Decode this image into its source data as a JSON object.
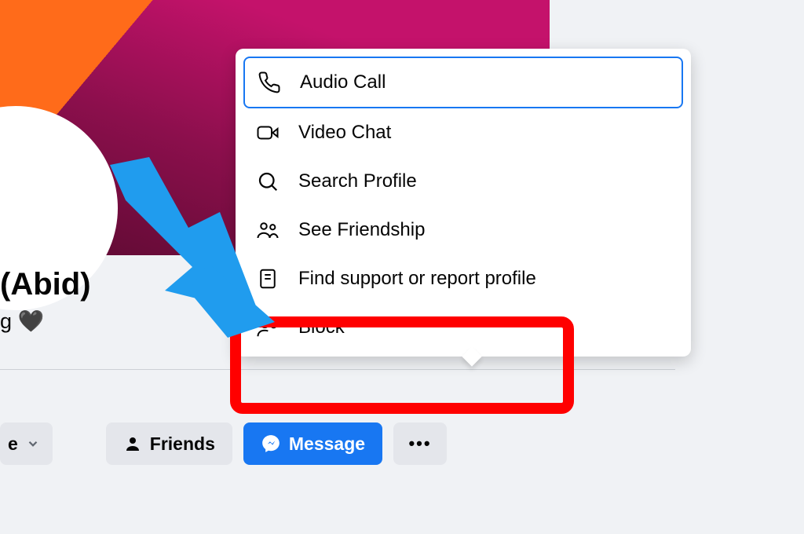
{
  "profile": {
    "name_visible": "(Abid)",
    "subline_prefix": "g",
    "heart": "🖤"
  },
  "buttons": {
    "more_label": "e",
    "friends": "Friends",
    "message": "Message",
    "ellipsis": "•••"
  },
  "menu": {
    "items": [
      {
        "icon": "phone",
        "label": "Audio Call"
      },
      {
        "icon": "video",
        "label": "Video Chat"
      },
      {
        "icon": "search",
        "label": "Search Profile"
      },
      {
        "icon": "friends",
        "label": "See Friendship"
      },
      {
        "icon": "report",
        "label": "Find support or report profile"
      },
      {
        "icon": "block",
        "label": "Block"
      }
    ]
  }
}
